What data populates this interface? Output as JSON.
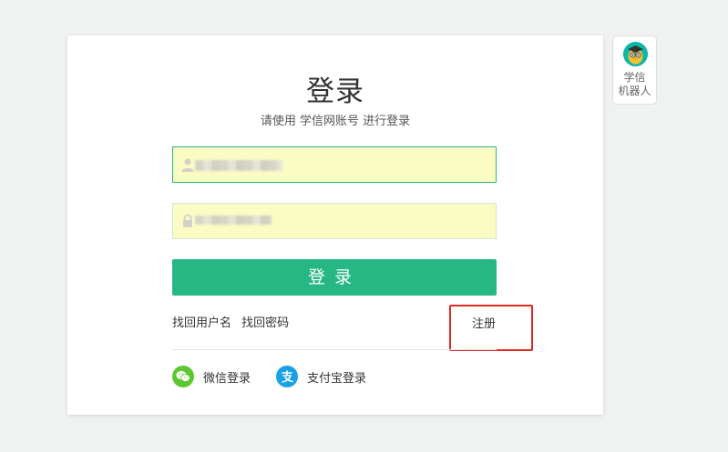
{
  "login": {
    "title": "登录",
    "subtitle": "请使用 学信网账号 进行登录",
    "username_icon": "user-icon",
    "password_icon": "lock-icon",
    "submit_label": "登录",
    "links": {
      "find_username": "找回用户名",
      "find_password": "找回密码",
      "register": "注册"
    },
    "third_party": [
      {
        "label": "微信登录",
        "icon": "wechat-icon",
        "color": "#5ec72f"
      },
      {
        "label": "支付宝登录",
        "icon": "alipay-icon",
        "color": "#19a1e6"
      }
    ]
  },
  "robot": {
    "label_line1": "学信",
    "label_line2": "机器人"
  },
  "colors": {
    "accent": "#26b784",
    "input_bg": "#fafcc4",
    "highlight": "#e02a22"
  }
}
